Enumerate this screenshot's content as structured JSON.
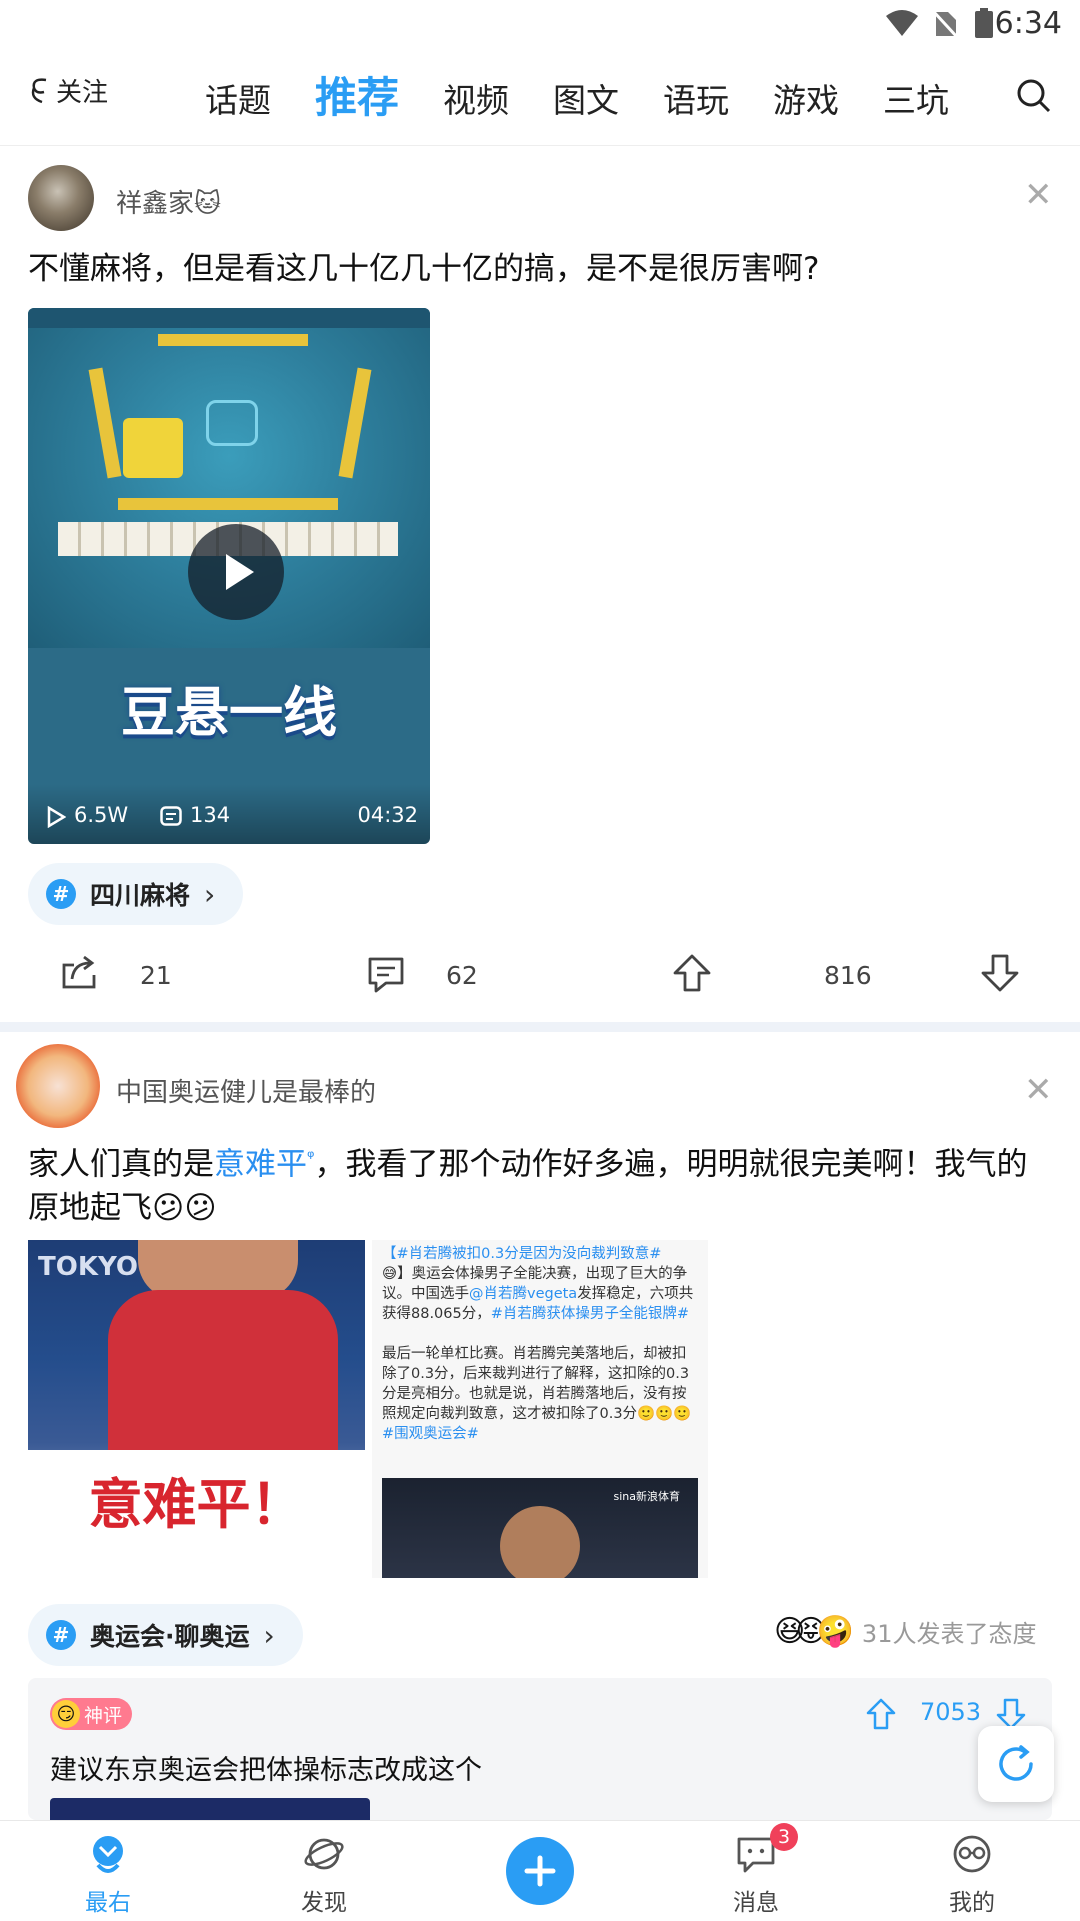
{
  "status_bar": {
    "time": "6:34"
  },
  "top_nav": {
    "follow_label": "关注",
    "tabs": [
      {
        "label": "话题"
      },
      {
        "label": "推荐",
        "active": true
      },
      {
        "label": "视频"
      },
      {
        "label": "图文"
      },
      {
        "label": "语玩"
      },
      {
        "label": "游戏"
      },
      {
        "label": "三坑"
      }
    ]
  },
  "post1": {
    "username": "祥鑫家🐱",
    "text": "不懂麻将，但是看这几十亿几十亿的搞，是不是很厉害啊?",
    "video": {
      "caption": "豆悬一线",
      "views": "6.5W",
      "comments": "134",
      "duration": "04:32"
    },
    "topic": "四川麻将",
    "shares": "21",
    "comments_count": "62",
    "likes": "816"
  },
  "post2": {
    "username": "中国奥运健儿是最棒的",
    "text_before": "家人们真的是",
    "text_link": "意难平",
    "text_after": "，我看了那个动作好多遍，明明就很完美啊！我气的原地起飞😕😕",
    "image1_caption": "意难平！",
    "image2": {
      "line1_tag": "【#肖若腾被扣0.3分是因为没向裁判致意#",
      "line2": "😅】奥运会体操男子全能决赛，出现了巨大的争议。中国选手",
      "mention": "@肖若腾vegeta",
      "line3": "发挥稳定，六项共获得88.065分，",
      "tag2": "#肖若腾获体操男子全能银牌#",
      "para2": "最后一轮单杠比赛。肖若腾完美落地后，却被扣除了0.3分，后来裁判进行了解释，这扣除的0.3分是亮相分。也就是说，肖若腾落地后，没有按照规定向裁判致意，这才被扣除了0.3分",
      "tag3": "#围观奥运会#",
      "watermark": "sina新浪体育"
    },
    "topic": "奥运会·聊奥运",
    "reactions_text": "31人发表了态度",
    "hot_comment": {
      "badge": "神评",
      "votes": "7053",
      "text": "建议东京奥运会把体操标志改成这个"
    }
  },
  "bottom_nav": {
    "items": [
      {
        "label": "最右",
        "active": true
      },
      {
        "label": "发现"
      },
      {
        "label": "消息",
        "badge": "3"
      },
      {
        "label": "我的"
      }
    ]
  },
  "colors": {
    "accent": "#2a9df4",
    "link": "#2a8ff0",
    "badge": "#f0405a"
  }
}
